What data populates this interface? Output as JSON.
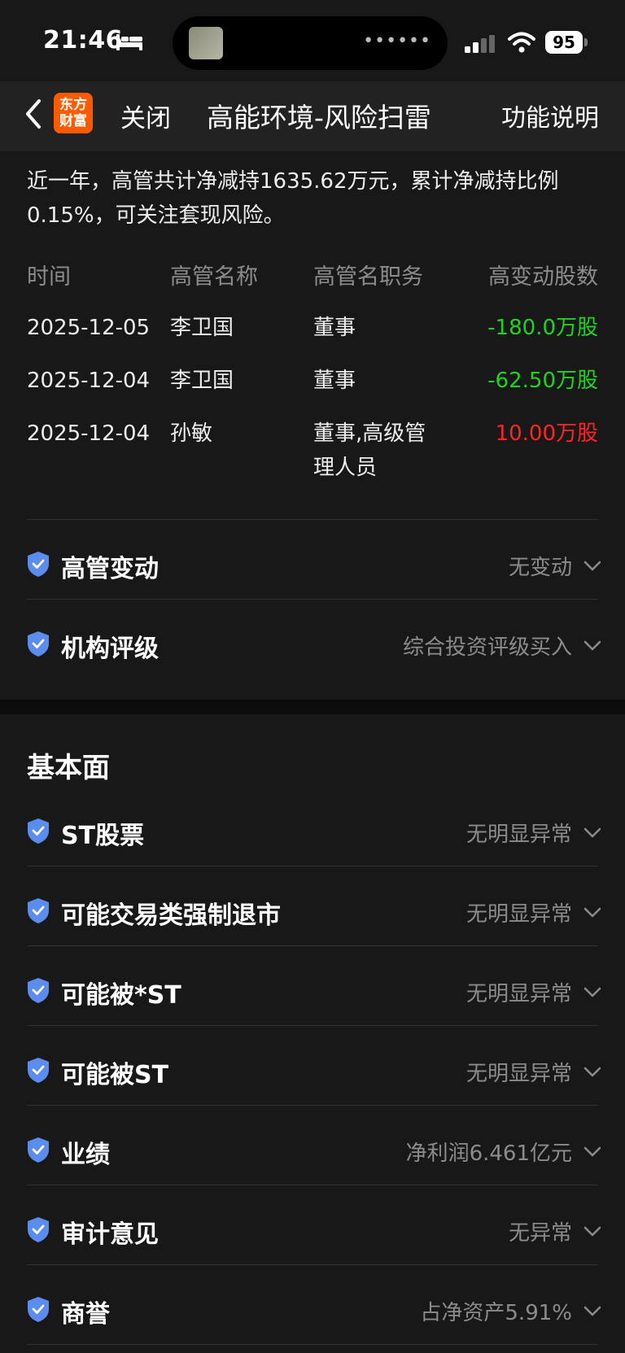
{
  "status": {
    "time": "21:46",
    "battery": "95"
  },
  "nav": {
    "logo_line1": "东方",
    "logo_line2": "财富",
    "close": "关闭",
    "title": "高能环境-风险扫雷",
    "help": "功能说明"
  },
  "summary": "近一年，高管共计净减持1635.62万元，累计净减持比例0.15%，可关注套现风险。",
  "table": {
    "headers": [
      "时间",
      "高管名称",
      "高管名职务",
      "高变动股数"
    ],
    "rows": [
      {
        "date": "2025-12-05",
        "name": "李卫国",
        "role": "董事",
        "change": "-180.0万股"
      },
      {
        "date": "2025-12-04",
        "name": "李卫国",
        "role": "董事",
        "change": "-62.50万股"
      },
      {
        "date": "2025-12-04",
        "name": "孙敏",
        "role": "董事,高级管理人员",
        "change": "10.00万股"
      }
    ]
  },
  "risk_items_top": [
    {
      "label": "高管变动",
      "value": "无变动"
    },
    {
      "label": "机构评级",
      "value": "综合投资评级买入"
    }
  ],
  "fundamentals": {
    "title": "基本面",
    "items": [
      {
        "label": "ST股票",
        "value": "无明显异常"
      },
      {
        "label": "可能交易类强制退市",
        "value": "无明显异常"
      },
      {
        "label": "可能被*ST",
        "value": "无明显异常"
      },
      {
        "label": "可能被ST",
        "value": "无明显异常"
      },
      {
        "label": "业绩",
        "value": "净利润6.461亿元"
      },
      {
        "label": "审计意见",
        "value": "无异常"
      },
      {
        "label": "商誉",
        "value": "占净资产5.91%"
      }
    ]
  },
  "colors": {
    "negative": "#1fd31f",
    "positive": "#ff2424",
    "shield": "#5b8def"
  }
}
